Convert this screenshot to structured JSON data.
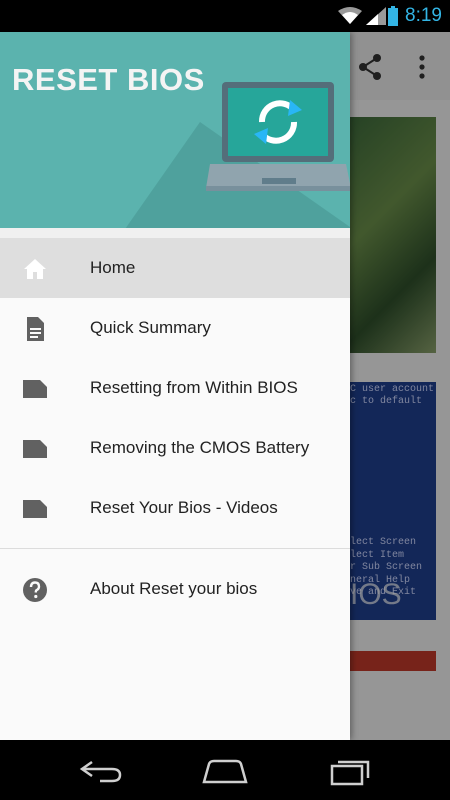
{
  "status_bar": {
    "time": "8:19"
  },
  "drawer": {
    "header_title": "RESET BIOS",
    "items": [
      {
        "label": "Home",
        "icon": "home-icon",
        "active": true
      },
      {
        "label": "Quick Summary",
        "icon": "document-icon"
      },
      {
        "label": "Resetting from Within BIOS",
        "icon": "file-icon"
      },
      {
        "label": "Removing the CMOS Battery",
        "icon": "file-icon"
      },
      {
        "label": "Reset Your Bios - Videos",
        "icon": "file-icon"
      }
    ],
    "secondary_items": [
      {
        "label": "About Reset your bios",
        "icon": "help-icon"
      }
    ]
  },
  "background": {
    "card2_text": "C user account\nc to default",
    "card2_lower_text": "lect Screen\nlect Item\nr Sub Screen\nneral Help\nve and Exit",
    "card2_label": "IOS"
  },
  "colors": {
    "header_teal": "#5bb3ae",
    "accent_blue": "#33b5e5",
    "active_row": "#dedede"
  }
}
